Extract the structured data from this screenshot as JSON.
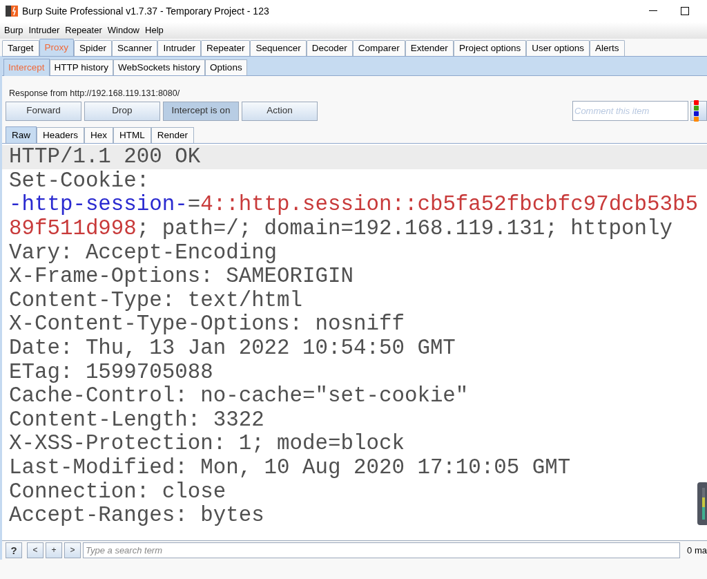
{
  "window": {
    "title": "Burp Suite Professional v1.7.37 - Temporary Project - 123"
  },
  "menu": [
    "Burp",
    "Intruder",
    "Repeater",
    "Window",
    "Help"
  ],
  "tabs": [
    {
      "label": "Target",
      "selected": false
    },
    {
      "label": "Proxy",
      "selected": true
    },
    {
      "label": "Spider",
      "selected": false
    },
    {
      "label": "Scanner",
      "selected": false
    },
    {
      "label": "Intruder",
      "selected": false
    },
    {
      "label": "Repeater",
      "selected": false
    },
    {
      "label": "Sequencer",
      "selected": false
    },
    {
      "label": "Decoder",
      "selected": false
    },
    {
      "label": "Comparer",
      "selected": false
    },
    {
      "label": "Extender",
      "selected": false
    },
    {
      "label": "Project options",
      "selected": false
    },
    {
      "label": "User options",
      "selected": false
    },
    {
      "label": "Alerts",
      "selected": false
    }
  ],
  "proxy_tabs": [
    {
      "label": "Intercept",
      "selected": true
    },
    {
      "label": "HTTP history",
      "selected": false
    },
    {
      "label": "WebSockets history",
      "selected": false
    },
    {
      "label": "Options",
      "selected": false
    }
  ],
  "intercept": {
    "source": "Response from http://192.168.119.131:8080/",
    "buttons": [
      {
        "label": "Forward",
        "pressed": false
      },
      {
        "label": "Drop",
        "pressed": false
      },
      {
        "label": "Intercept is on",
        "pressed": true
      },
      {
        "label": "Action",
        "pressed": false
      }
    ],
    "comment": {
      "placeholder": "Comment this item"
    }
  },
  "view_tabs": [
    {
      "label": "Raw",
      "selected": true
    },
    {
      "label": "Headers",
      "selected": false
    },
    {
      "label": "Hex",
      "selected": false
    },
    {
      "label": "HTML",
      "selected": false
    },
    {
      "label": "Render",
      "selected": false
    }
  ],
  "editor": {
    "lines": [
      {
        "highlighted": true,
        "segments": [
          {
            "kind": "plain",
            "text": "HTTP/1.1 200 OK"
          }
        ]
      },
      {
        "highlighted": false,
        "segments": [
          {
            "kind": "plain",
            "text": "Set-Cookie:"
          }
        ]
      },
      {
        "highlighted": false,
        "segments": [
          {
            "kind": "name",
            "text": "-http-session-"
          },
          {
            "kind": "plain",
            "text": "="
          },
          {
            "kind": "value",
            "text": "4::http.session::cb5fa52fbcbfc97dcb53b5"
          }
        ]
      },
      {
        "highlighted": false,
        "segments": [
          {
            "kind": "value",
            "text": "89f511d998"
          },
          {
            "kind": "plain",
            "text": "; path=/; domain=192.168.119.131; httponly"
          }
        ]
      },
      {
        "highlighted": false,
        "segments": [
          {
            "kind": "plain",
            "text": "Vary: Accept-Encoding"
          }
        ]
      },
      {
        "highlighted": false,
        "segments": [
          {
            "kind": "plain",
            "text": "X-Frame-Options: SAMEORIGIN"
          }
        ]
      },
      {
        "highlighted": false,
        "segments": [
          {
            "kind": "plain",
            "text": "Content-Type: text/html"
          }
        ]
      },
      {
        "highlighted": false,
        "segments": [
          {
            "kind": "plain",
            "text": "X-Content-Type-Options: nosniff"
          }
        ]
      },
      {
        "highlighted": false,
        "segments": [
          {
            "kind": "plain",
            "text": "Date: Thu, 13 Jan 2022 10:54:50 GMT"
          }
        ]
      },
      {
        "highlighted": false,
        "segments": [
          {
            "kind": "plain",
            "text": "ETag: 1599705088"
          }
        ]
      },
      {
        "highlighted": false,
        "segments": [
          {
            "kind": "plain",
            "text": "Cache-Control: no-cache=\"set-cookie\""
          }
        ]
      },
      {
        "highlighted": false,
        "segments": [
          {
            "kind": "plain",
            "text": "Content-Length: 3322"
          }
        ]
      },
      {
        "highlighted": false,
        "segments": [
          {
            "kind": "plain",
            "text": "X-XSS-Protection: 1; mode=block"
          }
        ]
      },
      {
        "highlighted": false,
        "segments": [
          {
            "kind": "plain",
            "text": "Last-Modified: Mon, 10 Aug 2020 17:10:05 GMT"
          }
        ]
      },
      {
        "highlighted": false,
        "segments": [
          {
            "kind": "plain",
            "text": "Connection: close"
          }
        ]
      },
      {
        "highlighted": false,
        "segments": [
          {
            "kind": "plain",
            "text": "Accept-Ranges: bytes"
          }
        ]
      }
    ]
  },
  "search_bar": {
    "buttons": [
      "?",
      "<",
      "+",
      ">"
    ],
    "placeholder": "Type a search term",
    "matches": "0 ma"
  }
}
